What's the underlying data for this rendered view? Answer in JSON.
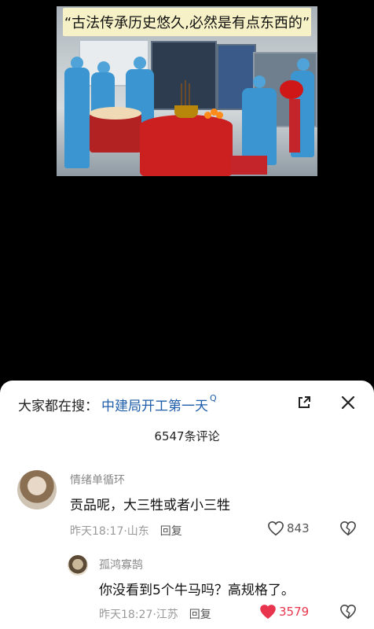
{
  "image": {
    "caption": "“古法传承历史悠久,必然是有点东西的”"
  },
  "comments_panel": {
    "search_prefix": "大家都在搜：",
    "search_term": "中建局开工第一天",
    "search_badge": "Q",
    "comment_count": "6547条评论",
    "comments": [
      {
        "user": "情绪单循环",
        "text": "贡品呢，大三牲或者小三牲",
        "time_location": "昨天18:17·山东",
        "reply_label": "回复",
        "likes": "843",
        "liked": false
      },
      {
        "user": "孤鸿寡鹄",
        "text": "你没看到5个牛马吗？高规格了。",
        "time_location": "昨天18:27·江苏",
        "reply_label": "回复",
        "likes": "3579",
        "liked": true
      }
    ]
  },
  "colors": {
    "link_blue": "#1f5eaa",
    "like_red": "#e8344c",
    "banner_yellow": "#f6f1c6"
  },
  "icons": [
    "expand-icon",
    "close-icon",
    "heart-outline-icon",
    "heart-filled-icon",
    "broken-heart-icon"
  ]
}
